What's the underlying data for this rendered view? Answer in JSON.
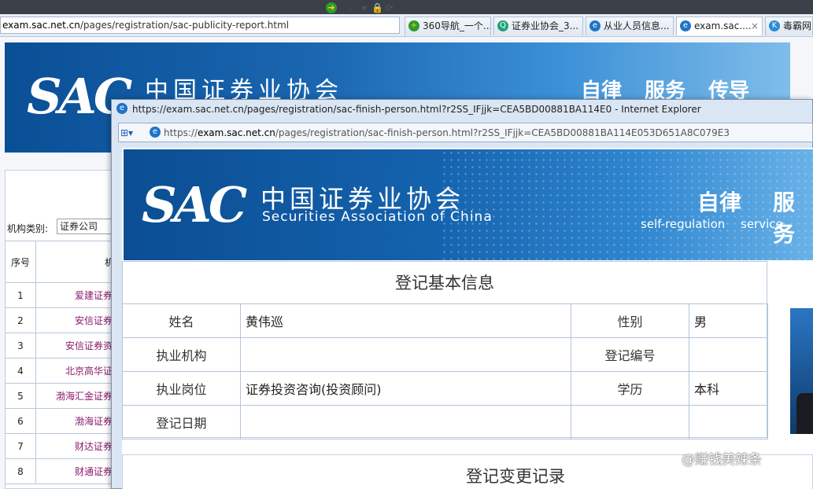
{
  "background_window": {
    "address": {
      "prefix": "exam.sac.net.cn",
      "path": "/pages/registration/sac-publicity-report.html"
    },
    "tabs": [
      {
        "label": "360导航_一个...",
        "icon": "360-icon"
      },
      {
        "label": "证券业协会_3...",
        "icon": "search-icon"
      },
      {
        "label": "从业人员信息...",
        "icon": "ie-icon"
      },
      {
        "label": "exam.sac....",
        "icon": "ie-icon",
        "active": true,
        "close": "×"
      },
      {
        "label": "毒霸网",
        "icon": "k-icon"
      }
    ],
    "banner": {
      "logo": "SAC",
      "title": "中国证券业协会",
      "slogan": "自律 服务 传导"
    },
    "filter": {
      "label": "机构类别:",
      "value": "证券公司"
    },
    "table": {
      "headers": [
        "序号",
        "机"
      ],
      "rows": [
        {
          "num": "1",
          "name": "爱建证券"
        },
        {
          "num": "2",
          "name": "安信证券"
        },
        {
          "num": "3",
          "name": "安信证券资"
        },
        {
          "num": "4",
          "name": "北京高华证"
        },
        {
          "num": "5",
          "name": "渤海汇金证券"
        },
        {
          "num": "6",
          "name": "渤海证券"
        },
        {
          "num": "7",
          "name": "财达证券"
        },
        {
          "num": "8",
          "name": "财通证券"
        }
      ]
    }
  },
  "popup_window": {
    "title": "https://exam.sac.net.cn/pages/registration/sac-finish-person.html?r2SS_IFjjk=CEA5BD00881BA114E0 - Internet Explorer",
    "address": {
      "scheme": "https://",
      "domain": "exam.sac.net.cn",
      "path": "/pages/registration/sac-finish-person.html?r2SS_IFjjk=CEA5BD00881BA114E053D651A8C079E3"
    },
    "banner": {
      "logo": "SAC",
      "title_cn": "中国证券业协会",
      "title_en": "Securities Association of China",
      "slogan_cn_1": "自律",
      "slogan_cn_2": "服务",
      "slogan_en_1": "self-regulation",
      "slogan_en_2": "service"
    },
    "info": {
      "title": "登记基本信息",
      "rows": [
        {
          "label1": "姓名",
          "value1": "黄伟巡",
          "label2": "性别",
          "value2": "男"
        },
        {
          "label1": "执业机构",
          "value1": "",
          "label2": "登记编号",
          "value2": ""
        },
        {
          "label1": "执业岗位",
          "value1": "证券投资咨询(投资顾问)",
          "label2": "学历",
          "value2": "本科"
        },
        {
          "label1": "登记日期",
          "value1": "",
          "label2": "",
          "value2": ""
        }
      ]
    },
    "changes": {
      "title": "登记变更记录"
    }
  },
  "watermark": "@赚钱美辣条",
  "colors": {
    "banner_blue": "#1462ad",
    "link_purple": "#8a1a6b",
    "table_border": "#b3c4da"
  }
}
